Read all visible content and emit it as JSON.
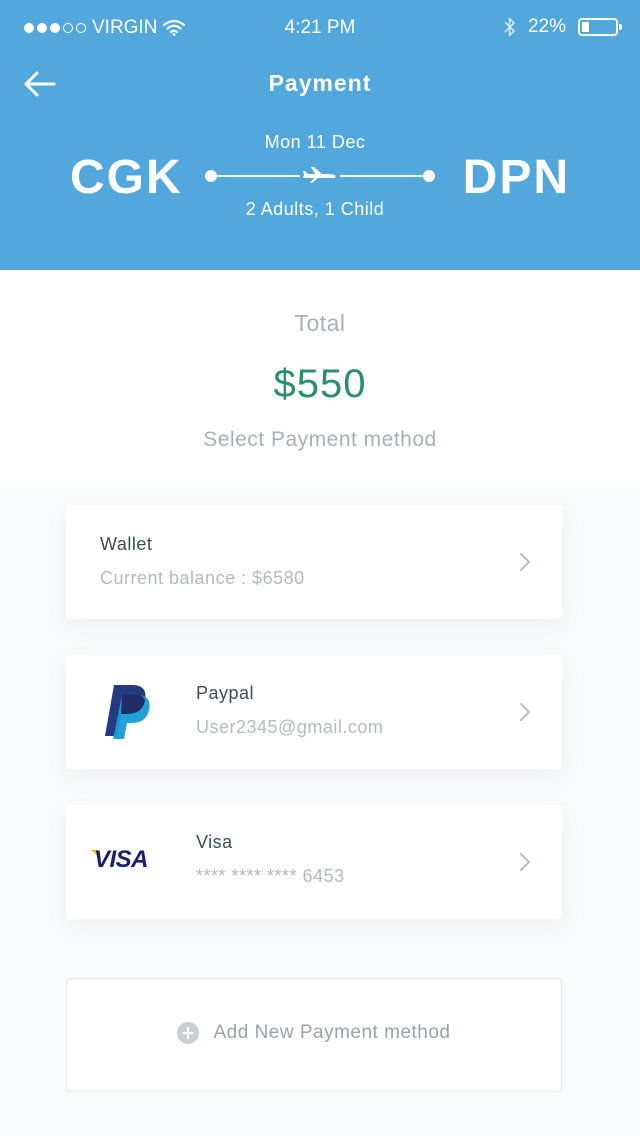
{
  "status_bar": {
    "carrier": "VIRGIN",
    "time": "4:21 PM",
    "battery_percent": "22%",
    "battery_level": 0.22
  },
  "header": {
    "title": "Payment",
    "origin": "CGK",
    "destination": "DPN",
    "date": "Mon 11 Dec",
    "passengers": "2 Adults, 1 Child"
  },
  "summary": {
    "total_label": "Total",
    "total_amount": "$550",
    "select_label": "Select Payment method"
  },
  "payment_methods": [
    {
      "title": "Wallet",
      "subtitle": "Current balance : $6580",
      "icon": "chevron-right-icon"
    },
    {
      "title": "Paypal",
      "subtitle": "User2345@gmail.com",
      "logo": "paypal-logo",
      "icon": "chevron-right-icon"
    },
    {
      "title": "Visa",
      "subtitle": "**** **** **** 6453",
      "logo_text": "VISA",
      "icon": "chevron-right-icon"
    }
  ],
  "add_method": {
    "label": "Add New Payment method",
    "icon": "plus-circle-icon"
  },
  "colors": {
    "header_bg": "#52a7dd",
    "amount": "#2b8f6a",
    "muted_text": "#a9b0b8",
    "paypal_dark": "#253b80",
    "paypal_light": "#179bd7",
    "visa_blue": "#1a1f71",
    "visa_gold": "#f7b600"
  }
}
